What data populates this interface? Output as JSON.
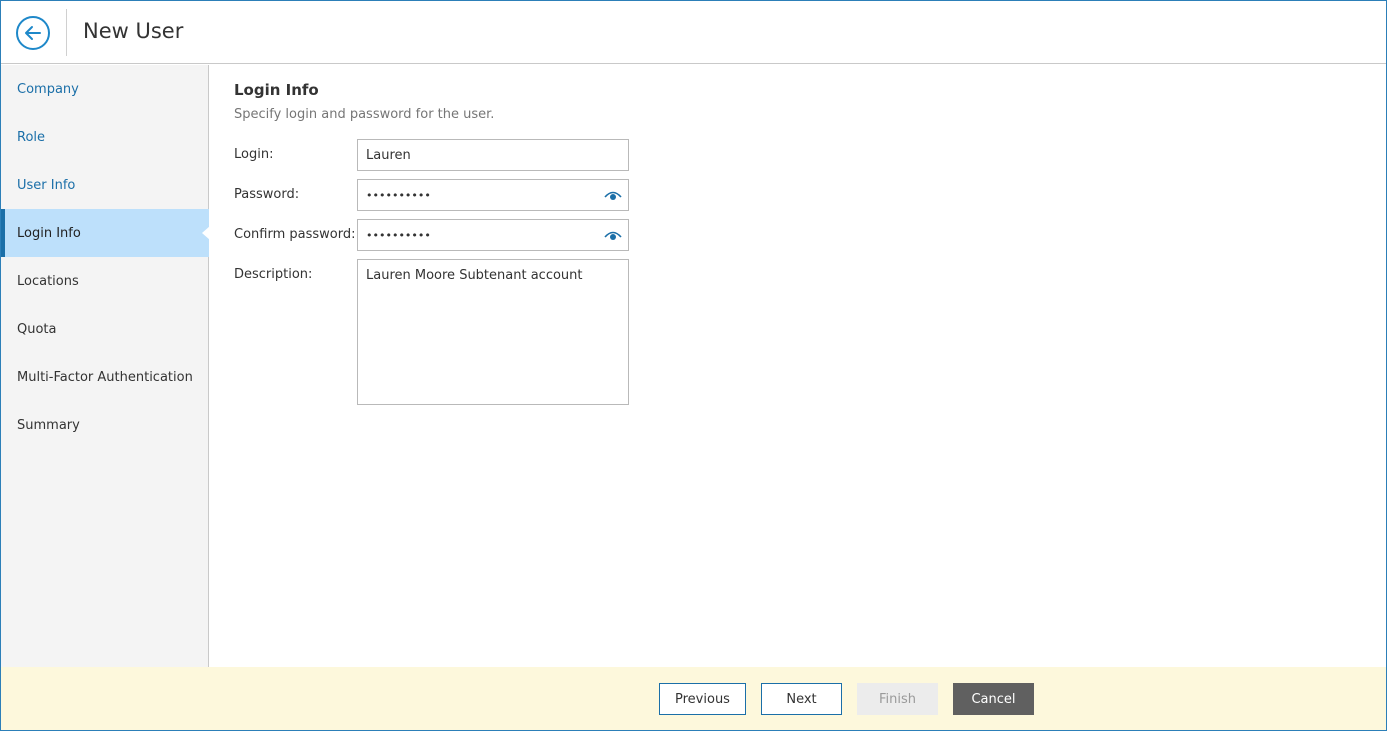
{
  "header": {
    "title": "New User",
    "back_icon": "arrow-left-icon"
  },
  "sidebar": {
    "items": [
      {
        "label": "Company",
        "state": "done"
      },
      {
        "label": "Role",
        "state": "done"
      },
      {
        "label": "User Info",
        "state": "done"
      },
      {
        "label": "Login Info",
        "state": "active"
      },
      {
        "label": "Locations",
        "state": "pending"
      },
      {
        "label": "Quota",
        "state": "pending"
      },
      {
        "label": "Multi-Factor Authentication",
        "state": "pending"
      },
      {
        "label": "Summary",
        "state": "pending"
      }
    ]
  },
  "main": {
    "title": "Login Info",
    "subtitle": "Specify login and password for the user.",
    "fields": {
      "login": {
        "label": "Login:",
        "value": "Lauren"
      },
      "password": {
        "label": "Password:",
        "value": "••••••••••"
      },
      "confirm_password": {
        "label": "Confirm password:",
        "value": "••••••••••"
      },
      "description": {
        "label": "Description:",
        "value": "Lauren Moore Subtenant account"
      }
    }
  },
  "footer": {
    "previous_label": "Previous",
    "next_label": "Next",
    "finish_label": "Finish",
    "cancel_label": "Cancel"
  },
  "colors": {
    "accent": "#1b6fa8",
    "active_nav_bg": "#bde0fb",
    "footer_bg": "#fdf8dc",
    "cancel_bg": "#606060"
  }
}
